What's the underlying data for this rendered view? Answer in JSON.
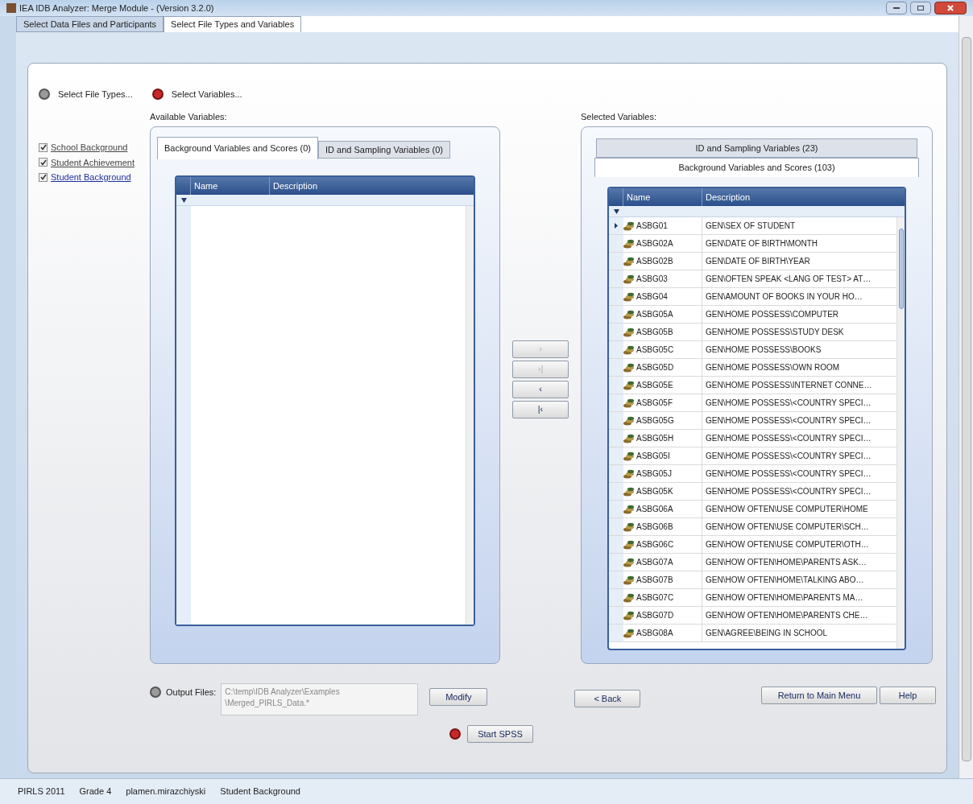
{
  "window": {
    "title": "IEA IDB Analyzer: Merge Module - (Version 3.2.0)"
  },
  "tabs": [
    {
      "label": "Select Data Files and Participants",
      "selected": false
    },
    {
      "label": "Select File Types and Variables",
      "selected": true
    }
  ],
  "steps": [
    {
      "label": "Select File Types...",
      "active": false
    },
    {
      "label": "Select Variables...",
      "active": true
    }
  ],
  "file_types": [
    {
      "label": "School Background",
      "checked": true,
      "selected": false
    },
    {
      "label": "Student Achievement",
      "checked": true,
      "selected": false
    },
    {
      "label": "Student Background",
      "checked": true,
      "selected": true
    }
  ],
  "available": {
    "label": "Available Variables:",
    "tabs": [
      {
        "label": "Background Variables and Scores (0)",
        "selected": true
      },
      {
        "label": "ID and Sampling Variables (0)",
        "selected": false
      }
    ],
    "columns": [
      "Name",
      "Description"
    ]
  },
  "transfer_buttons": [
    {
      "label": "›",
      "disabled": true
    },
    {
      "label": "›|",
      "disabled": true
    },
    {
      "label": "‹",
      "disabled": false
    },
    {
      "label": "|‹",
      "disabled": false
    }
  ],
  "selected": {
    "label": "Selected Variables:",
    "tabs": [
      {
        "label": "ID and Sampling Variables (23)",
        "selected": false
      },
      {
        "label": "Background Variables and Scores (103)",
        "selected": true
      }
    ],
    "columns": [
      "Name",
      "Description"
    ],
    "rows": [
      {
        "name": "ASBG01",
        "description": "GEN\\SEX OF STUDENT",
        "current": true
      },
      {
        "name": "ASBG02A",
        "description": "GEN\\DATE OF BIRTH\\MONTH",
        "current": false
      },
      {
        "name": "ASBG02B",
        "description": "GEN\\DATE OF BIRTH\\YEAR",
        "current": false
      },
      {
        "name": "ASBG03",
        "description": "GEN\\OFTEN SPEAK <LANG OF TEST> AT…",
        "current": false
      },
      {
        "name": "ASBG04",
        "description": "GEN\\AMOUNT OF BOOKS IN YOUR HO…",
        "current": false
      },
      {
        "name": "ASBG05A",
        "description": "GEN\\HOME POSSESS\\COMPUTER",
        "current": false
      },
      {
        "name": "ASBG05B",
        "description": "GEN\\HOME POSSESS\\STUDY DESK",
        "current": false
      },
      {
        "name": "ASBG05C",
        "description": "GEN\\HOME POSSESS\\BOOKS",
        "current": false
      },
      {
        "name": "ASBG05D",
        "description": "GEN\\HOME POSSESS\\OWN ROOM",
        "current": false
      },
      {
        "name": "ASBG05E",
        "description": "GEN\\HOME POSSESS\\INTERNET CONNE…",
        "current": false
      },
      {
        "name": "ASBG05F",
        "description": "GEN\\HOME POSSESS\\<COUNTRY SPECI…",
        "current": false
      },
      {
        "name": "ASBG05G",
        "description": "GEN\\HOME POSSESS\\<COUNTRY SPECI…",
        "current": false
      },
      {
        "name": "ASBG05H",
        "description": "GEN\\HOME POSSESS\\<COUNTRY SPECI…",
        "current": false
      },
      {
        "name": "ASBG05I",
        "description": "GEN\\HOME POSSESS\\<COUNTRY SPECI…",
        "current": false
      },
      {
        "name": "ASBG05J",
        "description": "GEN\\HOME POSSESS\\<COUNTRY SPECI…",
        "current": false
      },
      {
        "name": "ASBG05K",
        "description": "GEN\\HOME POSSESS\\<COUNTRY SPECI…",
        "current": false
      },
      {
        "name": "ASBG06A",
        "description": "GEN\\HOW OFTEN\\USE COMPUTER\\HOME",
        "current": false
      },
      {
        "name": "ASBG06B",
        "description": "GEN\\HOW OFTEN\\USE COMPUTER\\SCH…",
        "current": false
      },
      {
        "name": "ASBG06C",
        "description": "GEN\\HOW OFTEN\\USE COMPUTER\\OTH…",
        "current": false
      },
      {
        "name": "ASBG07A",
        "description": "GEN\\HOW OFTEN\\HOME\\PARENTS ASK…",
        "current": false
      },
      {
        "name": "ASBG07B",
        "description": "GEN\\HOW OFTEN\\HOME\\TALKING ABO…",
        "current": false
      },
      {
        "name": "ASBG07C",
        "description": "GEN\\HOW OFTEN\\HOME\\PARENTS MA…",
        "current": false
      },
      {
        "name": "ASBG07D",
        "description": "GEN\\HOW OFTEN\\HOME\\PARENTS CHE…",
        "current": false
      },
      {
        "name": "ASBG08A",
        "description": "GEN\\AGREE\\BEING IN SCHOOL",
        "current": false
      }
    ]
  },
  "output": {
    "label": "Output Files:",
    "active": false,
    "value": "C:\\temp\\IDB Analyzer\\Examples\n\\Merged_PIRLS_Data.*"
  },
  "buttons": {
    "modify": "Modify",
    "back": "< Back",
    "main_menu": "Return to Main Menu",
    "help": "Help",
    "start": "Start SPSS",
    "start_active": true
  },
  "status_bar": [
    "PIRLS 2011",
    "Grade 4",
    "plamen.mirazchiyski",
    "Student Background"
  ]
}
